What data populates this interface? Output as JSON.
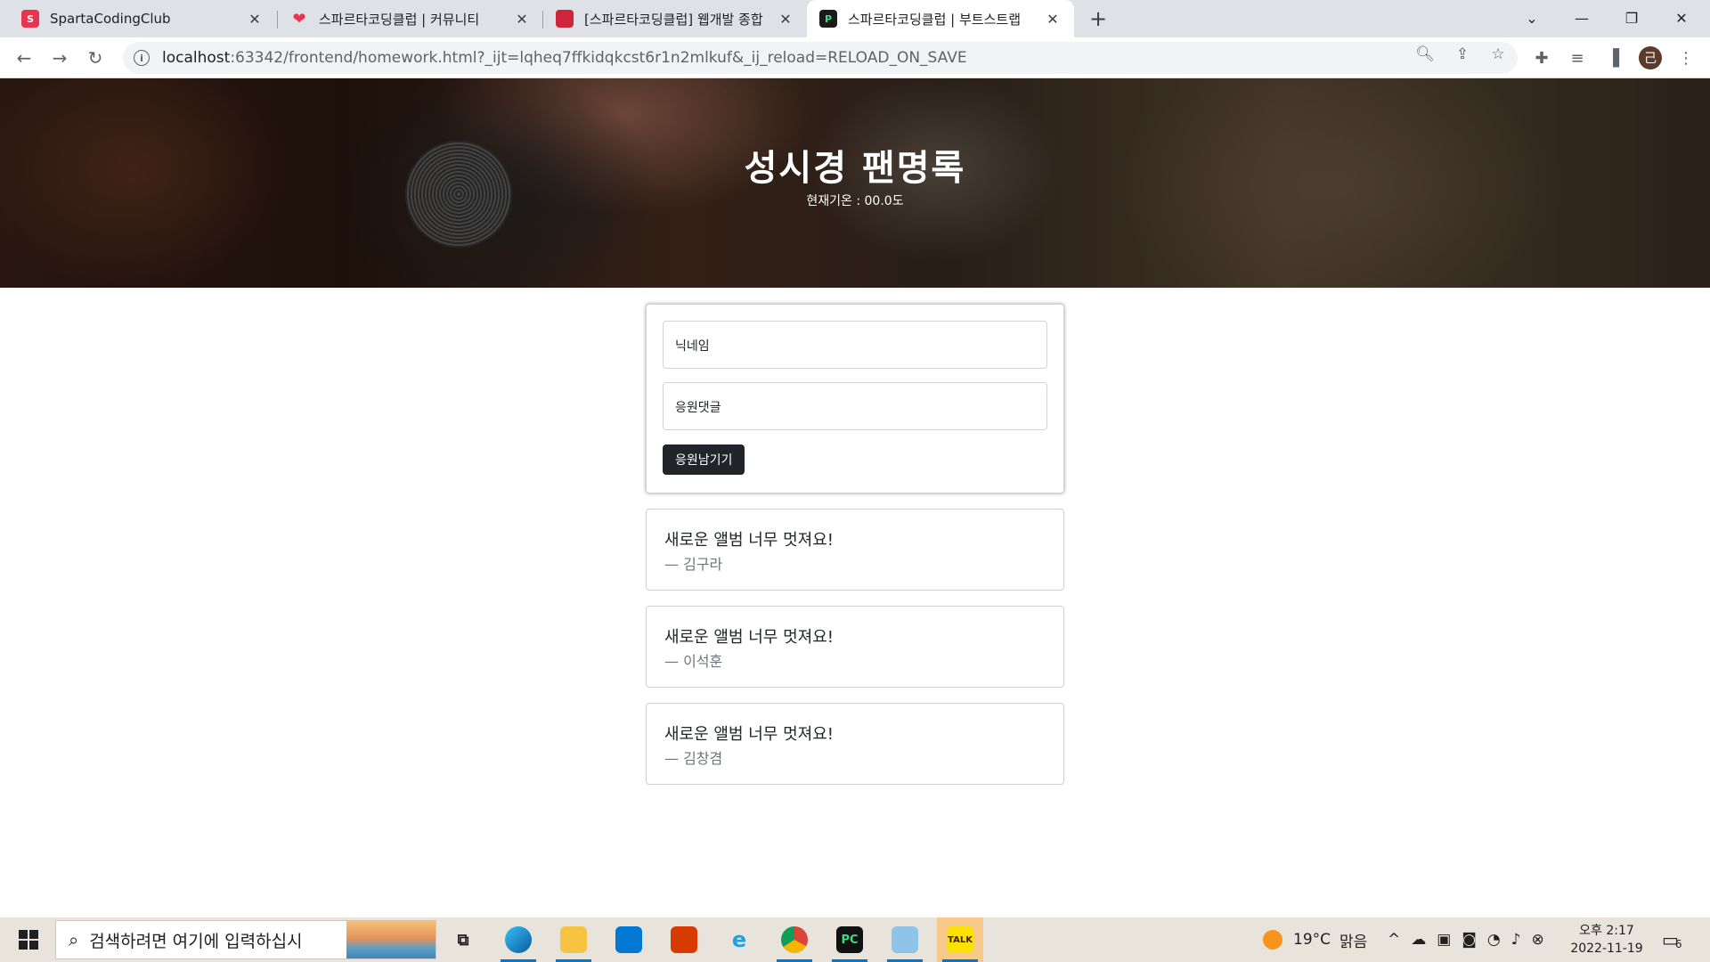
{
  "browser": {
    "tabs": [
      {
        "title": "SpartaCodingClub",
        "favicon_color": "#e8344e"
      },
      {
        "title": "스파르타코딩클럽 | 커뮤니티",
        "favicon_color": "#e8344e"
      },
      {
        "title": "[스파르타코딩클럽] 웹개발 종합",
        "favicon_color": "#d0243c"
      },
      {
        "title": "스파르타코딩클럽 | 부트스트랩",
        "favicon_color": "#1a1a1a"
      }
    ],
    "active_tab": 3,
    "url_host": "localhost",
    "url_rest": ":63342/frontend/homework.html?_ijt=lqheq7ffkidqkcst6r1n2mlkuf&_ij_reload=RELOAD_ON_SAVE",
    "profile_initial": "己"
  },
  "page": {
    "title": "성시경 팬명록",
    "temperature_text": "현재기온 : 00.0도",
    "form": {
      "nickname_placeholder": "닉네임",
      "comment_placeholder": "응원댓글",
      "submit_label": "응원남기기"
    },
    "comments": [
      {
        "text": "새로운 앨범 너무 멋져요!",
        "author": "— 김구라"
      },
      {
        "text": "새로운 앨범 너무 멋져요!",
        "author": "— 이석훈"
      },
      {
        "text": "새로운 앨범 너무 멋져요!",
        "author": "— 김창겸"
      }
    ]
  },
  "taskbar": {
    "search_placeholder": "검색하려면 여기에 입력하십시",
    "weather": "19°C",
    "weather_desc": "맑음",
    "time": "오후 2:17",
    "date": "2022-11-19",
    "notification_count": "6",
    "apps": [
      "task-view",
      "edge",
      "file-explorer",
      "microsoft-store",
      "office",
      "internet-explorer",
      "chrome",
      "pycharm",
      "notepad",
      "kakaotalk"
    ]
  }
}
